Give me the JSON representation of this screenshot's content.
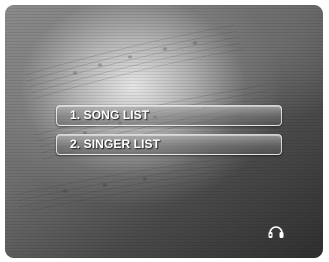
{
  "menu": {
    "items": [
      {
        "label": "1. SONG LIST"
      },
      {
        "label": "2. SINGER LIST"
      }
    ]
  },
  "status": {
    "icon": "headphones-icon"
  },
  "colors": {
    "text": "#ffffff",
    "background_dark": "#2f2f2f",
    "background_light": "#ececec"
  }
}
